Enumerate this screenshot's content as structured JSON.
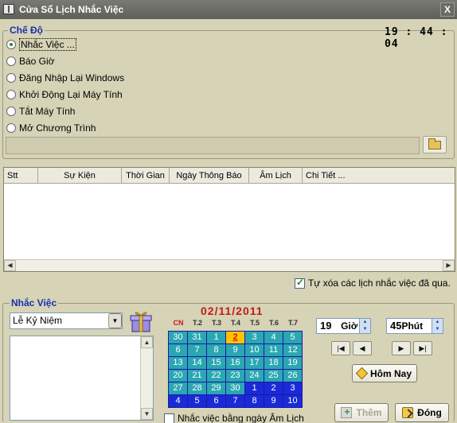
{
  "window": {
    "title": "Cửa Sổ Lịch Nhắc Việc",
    "close_label": "X"
  },
  "mode_group": {
    "title": "Chế Độ",
    "clock": "19 : 44 : 04",
    "options": [
      {
        "label": "Nhắc Việc ...",
        "selected": true
      },
      {
        "label": "Báo Giờ",
        "selected": false
      },
      {
        "label": "Đăng Nhập Lại Windows",
        "selected": false
      },
      {
        "label": "Khởi Động Lại Máy Tính",
        "selected": false
      },
      {
        "label": "Tắt Máy Tính",
        "selected": false
      },
      {
        "label": "Mở Chương Trình",
        "selected": false
      }
    ],
    "program_path": ""
  },
  "event_list": {
    "columns": [
      "Stt",
      "Sự Kiện",
      "Thời Gian",
      "Ngày Thông Báo",
      "Âm Lịch",
      "Chi Tiết ..."
    ],
    "rows": []
  },
  "auto_delete": {
    "label": "Tự xóa các lịch nhắc việc đã qua.",
    "checked": true
  },
  "reminder_group": {
    "title": "Nhắc Việc",
    "category": "Lễ Kỷ Niệm",
    "note": "",
    "lunar_checkbox": {
      "label": "Nhắc việc bằng ngày Âm Lịch",
      "checked": false
    }
  },
  "calendar": {
    "date_title": "02/11/2011",
    "weekdays": [
      "CN",
      "T.2",
      "T.3",
      "T.4",
      "T.5",
      "T.6",
      "T.7"
    ],
    "weeks": [
      [
        {
          "d": "30",
          "t": "cur"
        },
        {
          "d": "31",
          "t": "cur"
        },
        {
          "d": "1",
          "t": "cur"
        },
        {
          "d": "2",
          "t": "today"
        },
        {
          "d": "3",
          "t": "cur"
        },
        {
          "d": "4",
          "t": "cur"
        },
        {
          "d": "5",
          "t": "cur"
        }
      ],
      [
        {
          "d": "6",
          "t": "cur"
        },
        {
          "d": "7",
          "t": "cur"
        },
        {
          "d": "8",
          "t": "cur"
        },
        {
          "d": "9",
          "t": "cur"
        },
        {
          "d": "10",
          "t": "cur"
        },
        {
          "d": "11",
          "t": "cur"
        },
        {
          "d": "12",
          "t": "cur"
        }
      ],
      [
        {
          "d": "13",
          "t": "cur"
        },
        {
          "d": "14",
          "t": "cur"
        },
        {
          "d": "15",
          "t": "cur"
        },
        {
          "d": "16",
          "t": "cur"
        },
        {
          "d": "17",
          "t": "cur"
        },
        {
          "d": "18",
          "t": "cur"
        },
        {
          "d": "19",
          "t": "cur"
        }
      ],
      [
        {
          "d": "20",
          "t": "cur"
        },
        {
          "d": "21",
          "t": "cur"
        },
        {
          "d": "22",
          "t": "cur"
        },
        {
          "d": "23",
          "t": "cur"
        },
        {
          "d": "24",
          "t": "cur"
        },
        {
          "d": "25",
          "t": "cur"
        },
        {
          "d": "26",
          "t": "cur"
        }
      ],
      [
        {
          "d": "27",
          "t": "cur"
        },
        {
          "d": "28",
          "t": "cur"
        },
        {
          "d": "29",
          "t": "cur"
        },
        {
          "d": "30",
          "t": "cur"
        },
        {
          "d": "1",
          "t": "off"
        },
        {
          "d": "2",
          "t": "off"
        },
        {
          "d": "3",
          "t": "off"
        }
      ],
      [
        {
          "d": "4",
          "t": "off"
        },
        {
          "d": "5",
          "t": "off"
        },
        {
          "d": "6",
          "t": "off"
        },
        {
          "d": "7",
          "t": "off"
        },
        {
          "d": "8",
          "t": "off"
        },
        {
          "d": "9",
          "t": "off"
        },
        {
          "d": "10",
          "t": "off"
        }
      ]
    ]
  },
  "time": {
    "hour": "19",
    "hour_unit": "Giờ",
    "minute": "45",
    "minute_unit": "Phút"
  },
  "nav": {
    "first": "|◀",
    "prev": "◀",
    "next": "▶",
    "last": "▶|"
  },
  "buttons": {
    "today": "Hôm Nay",
    "add": "Thêm",
    "close": "Đóng"
  },
  "icons": {
    "app": "calendar-app-icon",
    "folder": "folder-open-icon",
    "gift": "gift-icon"
  }
}
